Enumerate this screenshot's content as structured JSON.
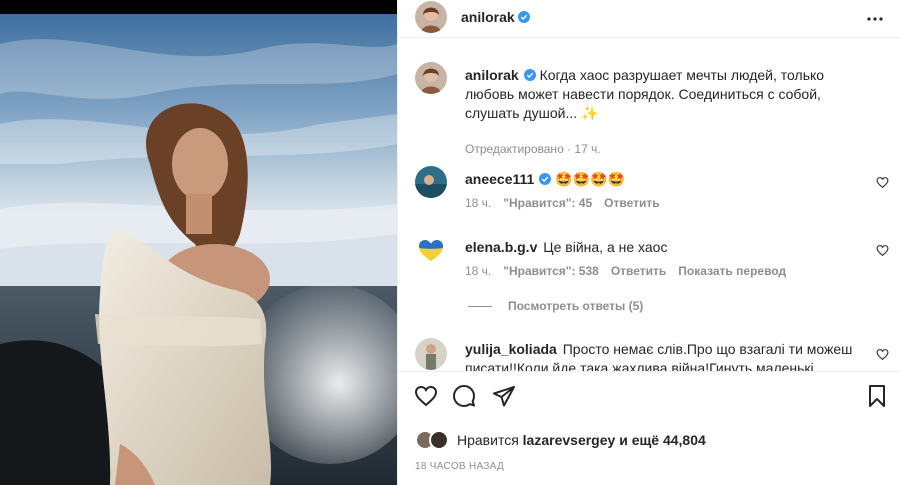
{
  "post": {
    "author": "anilorak",
    "caption": "Когда хаос разрушает мечты людей, только любовь может навести порядок. Соединиться с собой, слушать душой... ✨",
    "caption_meta": "Отредактировано · 17 ч."
  },
  "comments": [
    {
      "user": "aneece111",
      "verified": true,
      "text": "🤩🤩🤩🤩",
      "time": "18 ч.",
      "likes": "\"Нравится\": 45",
      "reply_label": "Ответить"
    },
    {
      "user": "elena.b.g.v",
      "verified": false,
      "text": "Це війна, а не хаос",
      "time": "18 ч.",
      "likes": "\"Нравится\": 538",
      "reply_label": "Ответить",
      "translate_label": "Показать перевод"
    },
    {
      "user": "yulija_koliada",
      "verified": false,
      "text": "Просто немає слів.Про що взагалі ти можеш писати!!Коли йде така жахлива війна!Гинуть маленькі"
    }
  ],
  "view_replies_label": "Посмотреть ответы (5)",
  "likes": {
    "prefix": "Нравится",
    "user": "lazarevsergey",
    "suffix": "и ещё 44,804"
  },
  "timestamp": "18 ЧАСОВ НАЗАД",
  "icons": {
    "like": "heart-icon",
    "comment": "comment-icon",
    "share": "share-icon",
    "save": "bookmark-icon",
    "more": "more-icon",
    "verified": "verified-badge-icon"
  },
  "colors": {
    "verified": "#3897f0",
    "text": "#262626",
    "secondary": "#8e8e8e"
  }
}
